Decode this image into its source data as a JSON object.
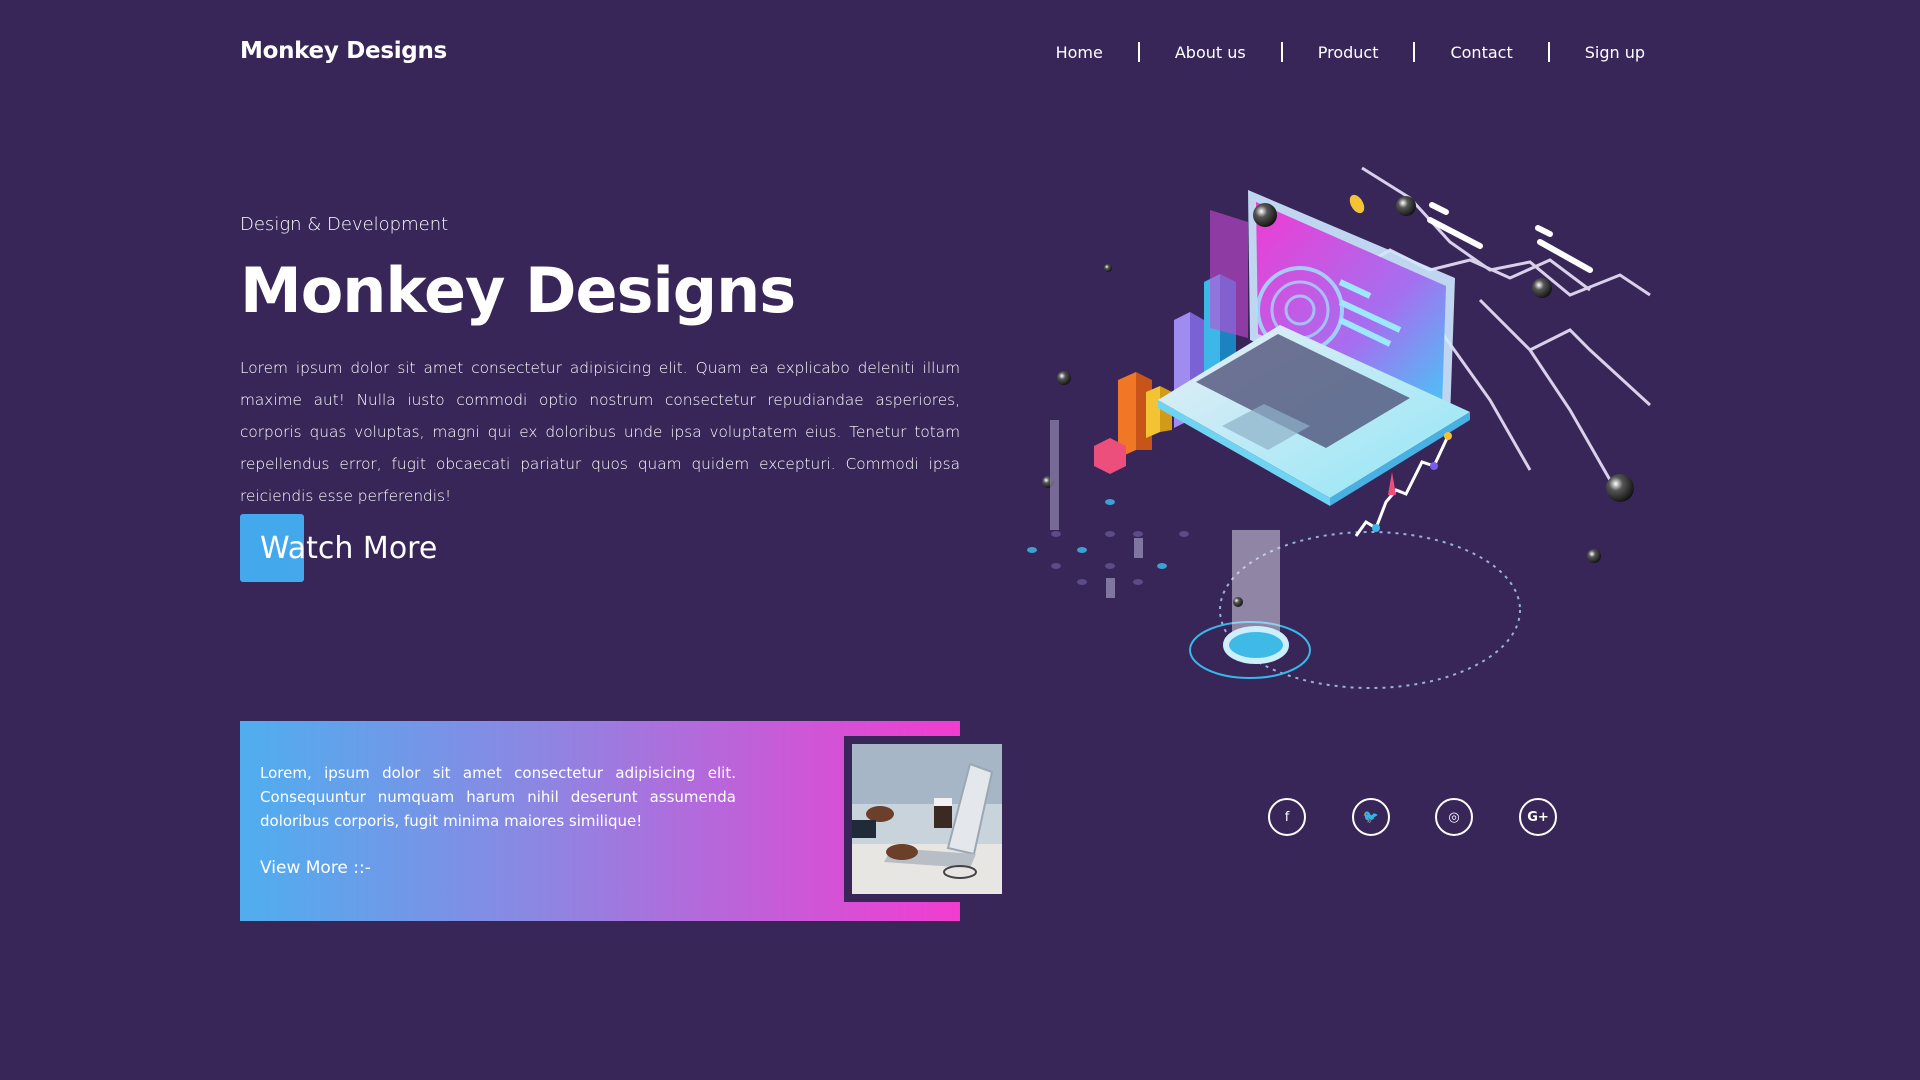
{
  "brand": "Monkey Designs",
  "nav": {
    "items": [
      "Home",
      "About us",
      "Product",
      "Contact",
      "Sign up"
    ]
  },
  "hero": {
    "eyebrow": "Design & Development",
    "title": "Monkey Designs",
    "text": "Lorem ipsum dolor sit amet consectetur adipisicing elit. Quam ea explicabo deleniti illum maxime aut! Nulla iusto commodi optio nostrum consectetur repudiandae asperiores, corporis quas voluptas, magni qui ex doloribus unde ipsa voluptatem eius. Tenetur totam repellendus error, fugit obcaecati pariatur quos quam quidem excepturi. Commodi ipsa reiciendis esse perferendis!",
    "button": "Watch More"
  },
  "card": {
    "text": "Lorem, ipsum dolor sit amet consectetur adipisicing elit. Consequuntur numquam harum nihil deserunt assumenda doloribus corporis, fugit minima maiores similique!",
    "link": "View More ::-"
  },
  "social": {
    "icons": [
      "facebook-icon",
      "twitter-icon",
      "instagram-icon",
      "google-plus-icon"
    ],
    "glyphs": [
      "f",
      "🐦",
      "◎",
      "G+"
    ]
  },
  "colors": {
    "background": "#382659",
    "accent": "#44a9ec",
    "gradient_start": "#4faeef",
    "gradient_end": "#f23cd0"
  }
}
